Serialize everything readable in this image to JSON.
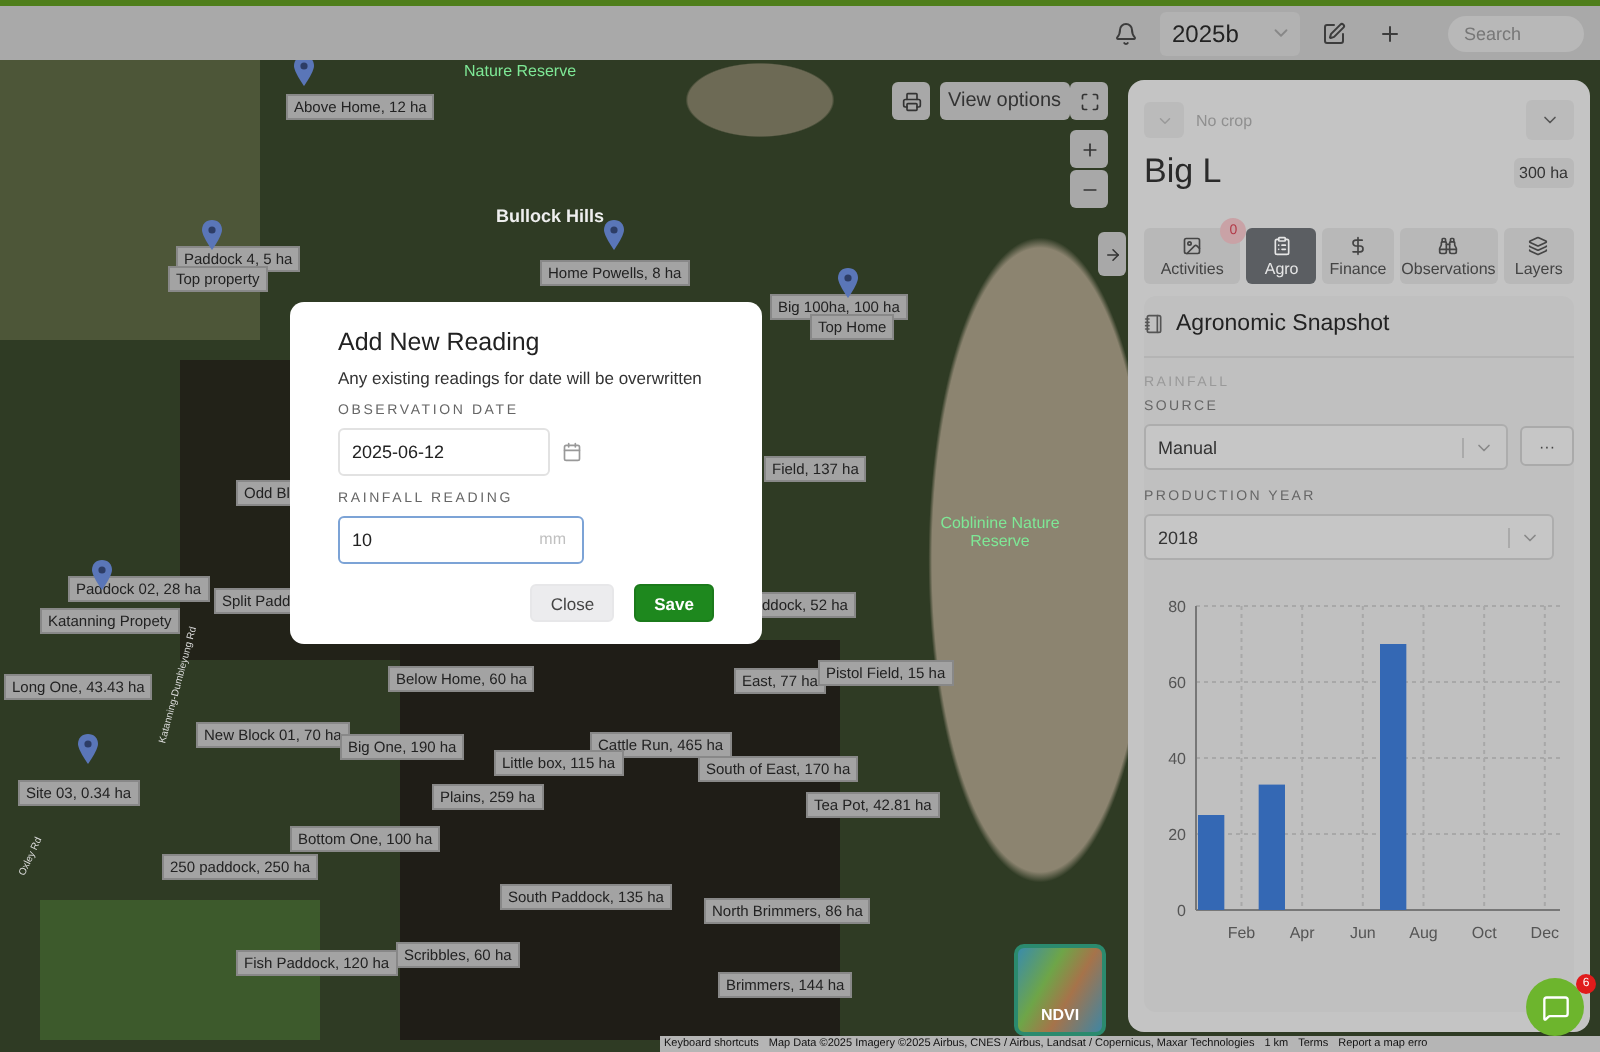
{
  "topbar": {
    "year": "2025b",
    "search": {
      "placeholder": "Search"
    }
  },
  "map": {
    "place_labels": [
      {
        "text": "Nature Reserve",
        "kind": "reserve"
      },
      {
        "text": "Bullock Hills",
        "kind": "locality"
      },
      {
        "text": "Coblinine Nature Reserve",
        "kind": "reserve"
      },
      {
        "text": "Katanning-Dumbleyung Rd",
        "kind": "road"
      },
      {
        "text": "Oxley Rd",
        "kind": "road"
      }
    ],
    "paddock_labels": [
      "Above Home, 12 ha",
      "Paddock 4, 5 ha",
      "Top property",
      "Home Powells, 8 ha",
      "Big 100ha, 100 ha",
      "Top Home",
      "Field, 137 ha",
      "Odd Bl",
      "Paddock 02, 28 ha",
      "Katanning Propety",
      "Split Padd",
      "ddock, 52 ha",
      "Long One, 43.43 ha",
      "Below Home, 60 ha",
      "East, 77 ha",
      "Pistol Field, 15 ha",
      "New Block 01, 70 ha",
      "Big One, 190 ha",
      "Cattle Run, 465 ha",
      "Little box, 115 ha",
      "South of East, 170 ha",
      "Site 03, 0.34 ha",
      "Plains, 259 ha",
      "Tea Pot, 42.81 ha",
      "Bottom One, 100 ha",
      "250 paddock, 250 ha",
      "South Paddock, 135 ha",
      "North Brimmers, 86 ha",
      "Fish Paddock, 120 ha",
      "Scribbles, 60 ha",
      "Brimmers, 144 ha"
    ],
    "view_options": "View options",
    "ndvi": "NDVI",
    "attribution": [
      "Keyboard shortcuts",
      "Map Data ©2025 Imagery ©2025 Airbus, CNES / Airbus, Landsat / Copernicus, Maxar Technologies",
      "1 km",
      "Terms",
      "Report a map erro"
    ]
  },
  "panel": {
    "crop": {
      "placeholder": "No crop"
    },
    "title": "Big L",
    "area": "300 ha",
    "tabs": [
      {
        "label": "Activities",
        "kind": "activities",
        "selected": false,
        "badge": "0"
      },
      {
        "label": "Agro",
        "kind": "agro",
        "selected": true
      },
      {
        "label": "Finance",
        "kind": "finance",
        "selected": false
      },
      {
        "label": "Observations",
        "kind": "observations",
        "selected": false
      },
      {
        "label": "Layers",
        "kind": "layers",
        "selected": false
      }
    ],
    "section_title": "Agronomic Snapshot",
    "group_label": "RAINFALL",
    "source": {
      "label": "SOURCE",
      "value": "Manual",
      "more": "···"
    },
    "production_year": {
      "label": "PRODUCTION YEAR",
      "value": "2018"
    },
    "chart_data": {
      "type": "bar",
      "categories": [
        null,
        "Feb",
        null,
        "Apr",
        null,
        "Jun",
        null,
        "Aug",
        null,
        "Oct",
        null,
        "Dec"
      ],
      "series": [
        {
          "color": "#3468b4",
          "values": [
            25,
            null,
            33,
            null,
            null,
            null,
            70,
            null,
            null,
            null,
            null,
            null
          ]
        }
      ],
      "ylim": [
        0,
        80
      ],
      "yticks": [
        0,
        20,
        40,
        60,
        80
      ],
      "grid": true
    }
  },
  "dialog": {
    "title": "Add New Reading",
    "subtitle": "Any existing readings for date will be overwritten",
    "date": {
      "label": "OBSERVATION DATE",
      "value": "2025-06-12"
    },
    "reading": {
      "label": "RAINFALL READING",
      "value": "10",
      "unit": "mm"
    },
    "buttons": [
      {
        "label": "Close",
        "kind": "secondary"
      },
      {
        "label": "Save",
        "kind": "primary"
      }
    ]
  },
  "chat": {
    "badge": "6"
  }
}
